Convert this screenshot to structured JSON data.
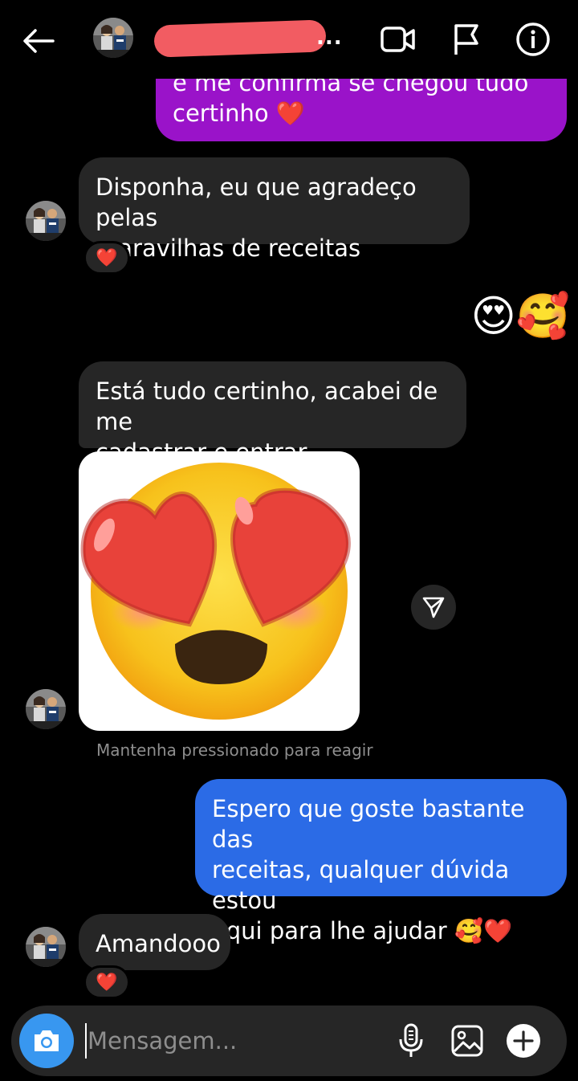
{
  "header": {
    "contact_name_suffix": "...",
    "icons": [
      "back-arrow-icon",
      "video-call-icon",
      "flag-icon",
      "info-icon"
    ]
  },
  "messages": [
    {
      "id": "m1",
      "direction": "sent",
      "text": "e me confirma se chegou tudo\ncertinho ❤️"
    },
    {
      "id": "m2",
      "direction": "received",
      "text": "Disponha, eu que agradeço pelas\nmaravilhas de receitas",
      "reaction": "❤️"
    },
    {
      "id": "m3",
      "direction": "sent",
      "text": "😍🥰"
    },
    {
      "id": "m4",
      "direction": "received",
      "text": "Está tudo certinho, acabei de me\ncadastrar e entrar"
    },
    {
      "id": "m5",
      "direction": "received",
      "type": "sticker",
      "sticker": "smiling-face-with-heart-eyes"
    },
    {
      "id": "m6",
      "direction": "sent",
      "text": "Espero que goste bastante das\nreceitas, qualquer dúvida estou\naqui para lhe ajudar 🥰❤️"
    },
    {
      "id": "m7",
      "direction": "received",
      "text": "Amandooo",
      "reaction": "❤️"
    }
  ],
  "hint": "Mantenha pressionado para reagir",
  "composer": {
    "placeholder": "Mensagem...",
    "icons": [
      "camera-icon",
      "microphone-icon",
      "gallery-icon",
      "plus-icon"
    ]
  },
  "colors": {
    "background": "#000000",
    "received_bubble": "#262626",
    "sent_purple": "#9a13c9",
    "sent_blue": "#2b6be6",
    "camera_button": "#3897f0",
    "hint_text": "#8e8e8e"
  }
}
